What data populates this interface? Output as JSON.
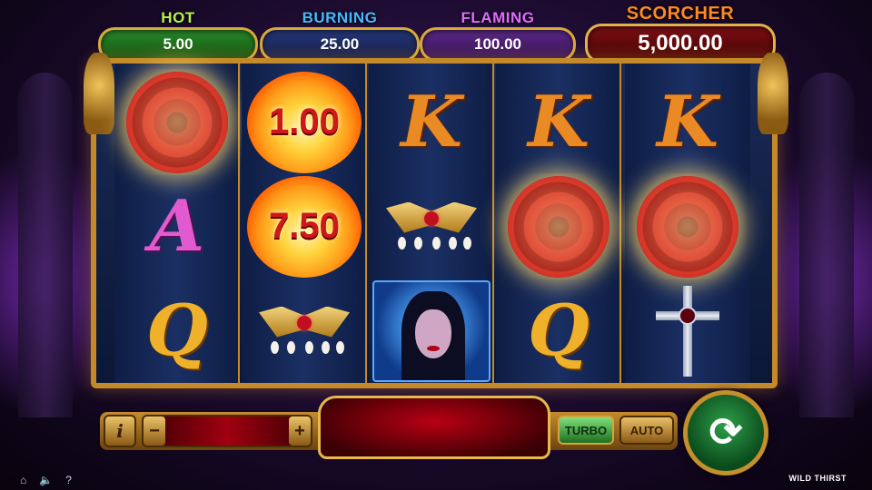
{
  "jackpots": {
    "hot": {
      "label": "HOT",
      "value": "5.00"
    },
    "burning": {
      "label": "BURNING",
      "value": "25.00"
    },
    "flaming": {
      "label": "FLAMING",
      "value": "100.00"
    },
    "scorcher": {
      "label": "SCORCHER",
      "value": "5,000.00"
    }
  },
  "reels": [
    {
      "symbols": [
        {
          "type": "rose"
        },
        {
          "type": "A",
          "text": "A"
        },
        {
          "type": "Q",
          "text": "Q"
        }
      ]
    },
    {
      "symbols": [
        {
          "type": "fireball",
          "value": "1.00"
        },
        {
          "type": "fireball",
          "value": "7.50"
        },
        {
          "type": "necklace"
        }
      ]
    },
    {
      "symbols": [
        {
          "type": "K",
          "text": "K"
        },
        {
          "type": "necklace"
        },
        {
          "type": "vampire"
        }
      ]
    },
    {
      "symbols": [
        {
          "type": "K",
          "text": "K"
        },
        {
          "type": "rose"
        },
        {
          "type": "Q",
          "text": "Q"
        }
      ]
    },
    {
      "symbols": [
        {
          "type": "K",
          "text": "K"
        },
        {
          "type": "rose"
        },
        {
          "type": "cross"
        }
      ]
    }
  ],
  "controls": {
    "info_label": "i",
    "minus_label": "−",
    "plus_label": "+",
    "turbo_label": "TURBO",
    "auto_label": "AUTO",
    "spin_icon": "refresh-icon"
  },
  "footer": {
    "home_icon": "⌂",
    "sound_icon": "🔈",
    "help_icon": "?",
    "brand": "WILD THIRST"
  }
}
